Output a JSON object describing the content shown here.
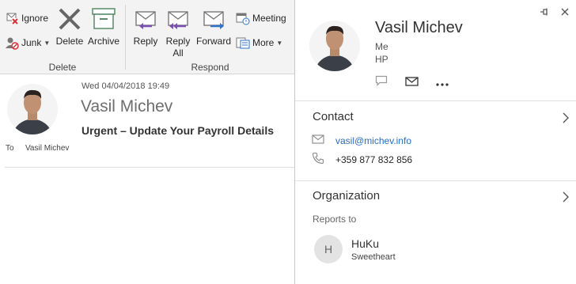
{
  "ribbon": {
    "ignore_label": "Ignore",
    "junk_label": "Junk",
    "delete_label": "Delete",
    "archive_label": "Archive",
    "reply_label": "Reply",
    "reply_all_line1": "Reply",
    "reply_all_line2": "All",
    "forward_label": "Forward",
    "meeting_label": "Meeting",
    "more_label": "More",
    "delete_group_label": "Delete",
    "respond_group_label": "Respond"
  },
  "message": {
    "date": "Wed 04/04/2018 19:49",
    "sender": "Vasil Michev",
    "subject": "Urgent – Update Your Payroll Details",
    "to_label": "To",
    "to_value": "Vasil Michev"
  },
  "card": {
    "name": "Vasil Michev",
    "line1": "Me",
    "line2": "HP",
    "contact_title": "Contact",
    "email": "vasil@michev.info",
    "phone": "+359 877 832 856",
    "organization_title": "Organization",
    "reports_to_label": "Reports to",
    "manager_initial": "H",
    "manager_name": "HuKu",
    "manager_title": "Sweetheart"
  },
  "colors": {
    "ribbon_bg": "#f3f3f3",
    "link": "#2b6cb8",
    "reply_arrow": "#7b4fb2",
    "forward_arrow": "#2e75c9",
    "ignore_red": "#d13438"
  }
}
